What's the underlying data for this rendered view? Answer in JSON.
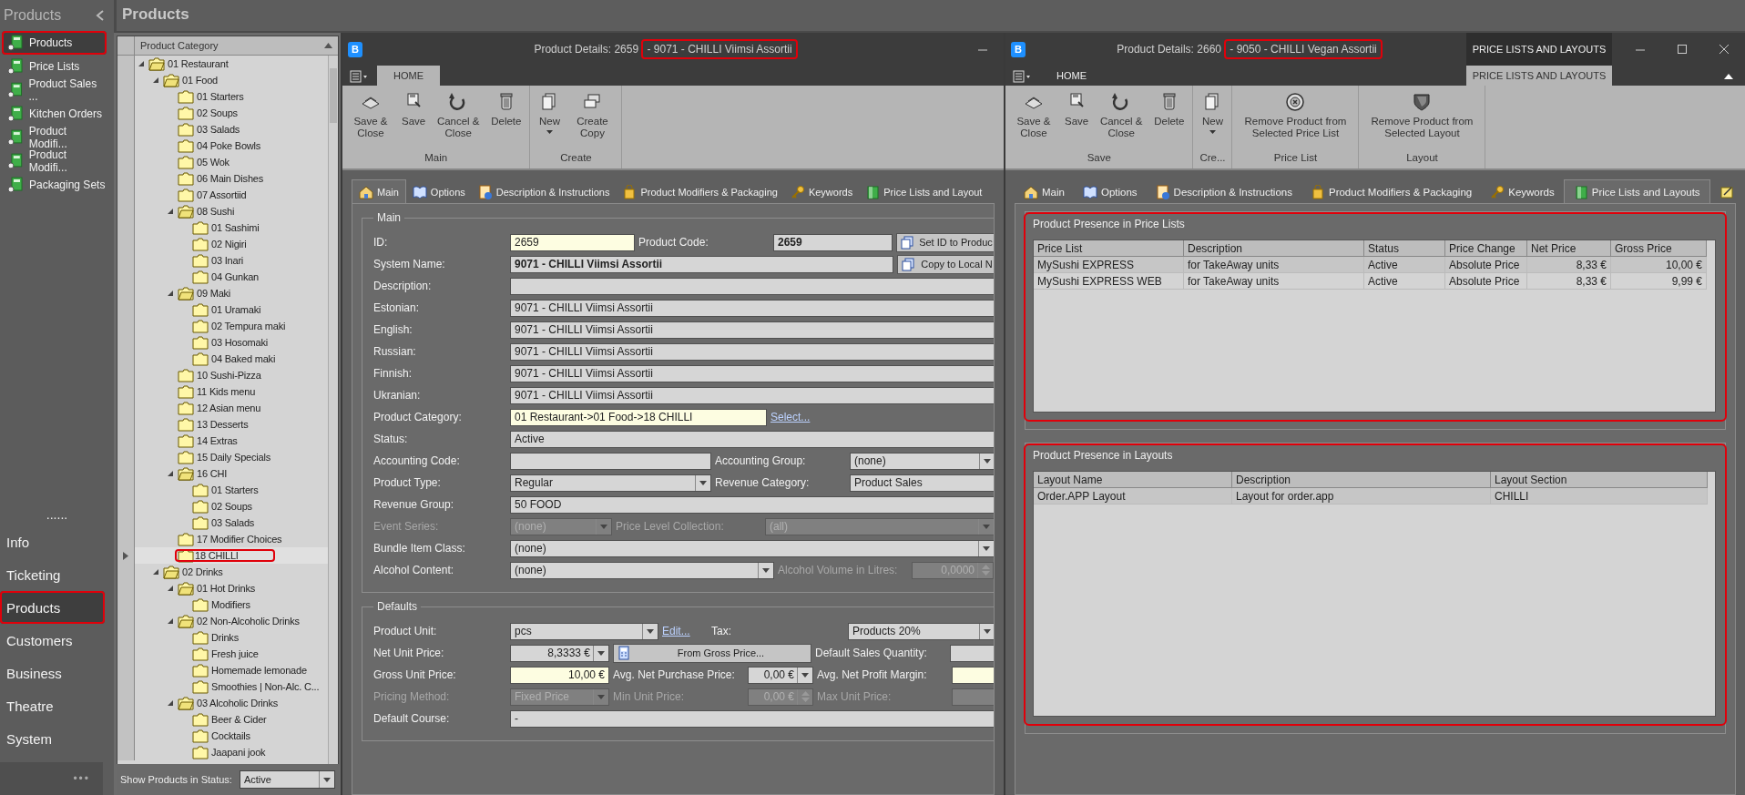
{
  "nav": {
    "title": "Products",
    "items": [
      {
        "label": "Products",
        "selected": true,
        "highlighted": true
      },
      {
        "label": "Price Lists",
        "selected": false,
        "highlighted": false
      },
      {
        "label": "Product Sales ...",
        "selected": false,
        "highlighted": false
      },
      {
        "label": "Kitchen Orders",
        "selected": false,
        "highlighted": false
      },
      {
        "label": "Product Modifi...",
        "selected": false,
        "highlighted": false
      },
      {
        "label": "Product Modifi...",
        "selected": false,
        "highlighted": false
      },
      {
        "label": "Packaging Sets",
        "selected": false,
        "highlighted": false
      }
    ],
    "divider": "......",
    "sections": [
      {
        "label": "Info",
        "selected": false,
        "highlighted": false
      },
      {
        "label": "Ticketing",
        "selected": false,
        "highlighted": false
      },
      {
        "label": "Products",
        "selected": true,
        "highlighted": true
      },
      {
        "label": "Customers",
        "selected": false,
        "highlighted": false
      },
      {
        "label": "Business",
        "selected": false,
        "highlighted": false
      },
      {
        "label": "Theatre",
        "selected": false,
        "highlighted": false
      },
      {
        "label": "System",
        "selected": false,
        "highlighted": false
      }
    ],
    "more": "•••"
  },
  "page_title": "Products",
  "tree": {
    "column": "Product Category",
    "items": [
      {
        "label": "01 Restaurant",
        "selected": false,
        "expanded": true,
        "children": [
          {
            "label": "01 Food",
            "selected": false,
            "expanded": true,
            "children": [
              {
                "label": "01 Starters",
                "selected": false
              },
              {
                "label": "02 Soups",
                "selected": false
              },
              {
                "label": "03 Salads",
                "selected": false
              },
              {
                "label": "04 Poke Bowls",
                "selected": false
              },
              {
                "label": "05 Wok",
                "selected": false
              },
              {
                "label": "06 Main Dishes",
                "selected": false
              },
              {
                "label": "07 Assortiid",
                "selected": false
              },
              {
                "label": "08 Sushi",
                "selected": false,
                "expanded": true,
                "children": [
                  {
                    "label": "01 Sashimi",
                    "selected": false
                  },
                  {
                    "label": "02 Nigiri",
                    "selected": false
                  },
                  {
                    "label": "03 Inari",
                    "selected": false
                  },
                  {
                    "label": "04 Gunkan",
                    "selected": false
                  }
                ]
              },
              {
                "label": "09 Maki",
                "selected": false,
                "expanded": true,
                "children": [
                  {
                    "label": "01 Uramaki",
                    "selected": false
                  },
                  {
                    "label": "02 Tempura maki",
                    "selected": false
                  },
                  {
                    "label": "03 Hosomaki",
                    "selected": false
                  },
                  {
                    "label": "04 Baked maki",
                    "selected": false
                  }
                ]
              },
              {
                "label": "10 Sushi-Pizza",
                "selected": false
              },
              {
                "label": "11 Kids menu",
                "selected": false
              },
              {
                "label": "12 Asian menu",
                "selected": false
              },
              {
                "label": "13 Desserts",
                "selected": false
              },
              {
                "label": "14 Extras",
                "selected": false
              },
              {
                "label": "15 Daily Specials",
                "selected": false
              },
              {
                "label": "16 CHI",
                "selected": false,
                "expanded": true,
                "children": [
                  {
                    "label": "01 Starters",
                    "selected": false
                  },
                  {
                    "label": "02 Soups",
                    "selected": false
                  },
                  {
                    "label": "03 Salads",
                    "selected": false
                  }
                ]
              },
              {
                "label": "17 Modifier Choices",
                "selected": false
              },
              {
                "label": "18 CHILLI",
                "selected": true,
                "highlighted": true
              }
            ]
          },
          {
            "label": "02 Drinks",
            "selected": false,
            "expanded": true,
            "children": [
              {
                "label": "01 Hot Drinks",
                "selected": false,
                "expanded": true,
                "children": [
                  {
                    "label": "Modifiers",
                    "selected": false
                  }
                ]
              },
              {
                "label": "02 Non-Alcoholic Drinks",
                "selected": false,
                "expanded": true,
                "children": [
                  {
                    "label": "Drinks",
                    "selected": false
                  },
                  {
                    "label": "Fresh juice",
                    "selected": false
                  },
                  {
                    "label": "Homemade lemonade",
                    "selected": false
                  },
                  {
                    "label": "Smoothies | Non-Alc. C...",
                    "selected": false
                  }
                ]
              },
              {
                "label": "03 Alcoholic Drinks",
                "selected": false,
                "expanded": true,
                "children": [
                  {
                    "label": "Beer & Cider",
                    "selected": false
                  },
                  {
                    "label": "Cocktails",
                    "selected": false
                  },
                  {
                    "label": "Jaapani jook",
                    "selected": false
                  }
                ]
              }
            ]
          }
        ]
      }
    ],
    "filter_label": "Show Products in Status:",
    "filter_value": "Active"
  },
  "windows": [
    {
      "logo": "B",
      "title": "Product Details: 2659",
      "title_marked": "- 9071 - CHILLI Viimsi Assortii",
      "ribbon_tabs": [
        {
          "label": "HOME",
          "selected": true,
          "kind": "normal"
        }
      ],
      "ribbon_groups": [
        {
          "label": "Main",
          "buttons": [
            {
              "label": "Save & Close",
              "kind": "save_close"
            },
            {
              "label": "Save",
              "kind": "save"
            },
            {
              "label": "Cancel & Close",
              "kind": "cancel_close"
            },
            {
              "label": "Delete",
              "kind": "delete"
            }
          ]
        },
        {
          "label": "Create",
          "buttons": [
            {
              "label": "New",
              "kind": "new",
              "dropdown": true
            },
            {
              "label": "Create Copy",
              "kind": "create_copy"
            }
          ]
        }
      ],
      "tabs": [
        {
          "label": "Main",
          "kind": "main",
          "selected": true
        },
        {
          "label": "Options",
          "kind": "options",
          "selected": false
        },
        {
          "label": "Description & Instructions",
          "kind": "description",
          "selected": false
        },
        {
          "label": "Product Modifiers & Packaging",
          "kind": "modifiers",
          "selected": false
        },
        {
          "label": "Keywords",
          "kind": "keywords",
          "selected": false
        },
        {
          "label": "Price Lists and Layout",
          "kind": "price_lists",
          "selected": false
        }
      ],
      "content": {
        "kind": "form",
        "groups": [
          {
            "title": "Main",
            "rows": [
              {
                "items": [
                  {
                    "kind": "label",
                    "text": "ID:"
                  },
                  {
                    "kind": "input",
                    "value": "2659",
                    "required": true
                  },
                  {
                    "kind": "label",
                    "text": "Product Code:"
                  },
                  {
                    "kind": "input",
                    "value": "2659",
                    "bold": true
                  },
                  {
                    "kind": "copy_button",
                    "text": "Set ID to Produc"
                  }
                ]
              },
              {
                "items": [
                  {
                    "kind": "label",
                    "text": "System Name:"
                  },
                  {
                    "kind": "input",
                    "value": "9071 - CHILLI Viimsi Assortii",
                    "bold": true
                  },
                  {
                    "kind": "copy_button",
                    "text": "Copy to Local N"
                  }
                ]
              },
              {
                "items": [
                  {
                    "kind": "label",
                    "text": "Description:"
                  },
                  {
                    "kind": "input"
                  }
                ]
              },
              {
                "items": [
                  {
                    "kind": "label",
                    "text": "Estonian:"
                  },
                  {
                    "kind": "input",
                    "value": "9071 - CHILLI Viimsi Assortii"
                  }
                ]
              },
              {
                "items": [
                  {
                    "kind": "label",
                    "text": "English:"
                  },
                  {
                    "kind": "input",
                    "value": "9071 - CHILLI Viimsi Assortii"
                  }
                ]
              },
              {
                "items": [
                  {
                    "kind": "label",
                    "text": "Russian:"
                  },
                  {
                    "kind": "input",
                    "value": "9071 - CHILLI Viimsi Assortii"
                  }
                ]
              },
              {
                "items": [
                  {
                    "kind": "label",
                    "text": "Finnish:"
                  },
                  {
                    "kind": "input",
                    "value": "9071 - CHILLI Viimsi Assortii"
                  }
                ]
              },
              {
                "items": [
                  {
                    "kind": "label",
                    "text": "Ukranian:"
                  },
                  {
                    "kind": "input",
                    "value": "9071 - CHILLI Viimsi Assortii"
                  }
                ]
              },
              {
                "items": [
                  {
                    "kind": "label",
                    "text": "Product Category:"
                  },
                  {
                    "kind": "input",
                    "value": "01 Restaurant->01 Food->18 CHILLI",
                    "required": true
                  },
                  {
                    "kind": "link",
                    "text": "Select..."
                  }
                ]
              },
              {
                "items": [
                  {
                    "kind": "label",
                    "text": "Status:"
                  },
                  {
                    "kind": "input",
                    "value": "Active"
                  }
                ]
              },
              {
                "items": [
                  {
                    "kind": "label",
                    "text": "Accounting Code:"
                  },
                  {
                    "kind": "input"
                  },
                  {
                    "kind": "label",
                    "text": "Accounting Group:"
                  },
                  {
                    "kind": "combo",
                    "value": "(none)"
                  }
                ]
              },
              {
                "items": [
                  {
                    "kind": "label",
                    "text": "Product Type:"
                  },
                  {
                    "kind": "combo",
                    "value": "Regular"
                  },
                  {
                    "kind": "label",
                    "text": "Revenue Category:"
                  },
                  {
                    "kind": "input",
                    "value": "Product Sales"
                  }
                ]
              },
              {
                "items": [
                  {
                    "kind": "label",
                    "text": "Revenue Group:"
                  },
                  {
                    "kind": "input",
                    "value": "50 FOOD"
                  }
                ]
              },
              {
                "items": [
                  {
                    "kind": "label",
                    "text": "Event Series:",
                    "disabled": true
                  },
                  {
                    "kind": "combo",
                    "value": "(none)",
                    "disabled": true
                  },
                  {
                    "kind": "label",
                    "text": "Price Level Collection:",
                    "disabled": true
                  },
                  {
                    "kind": "combo",
                    "value": "(all)",
                    "disabled": true
                  }
                ]
              },
              {
                "items": [
                  {
                    "kind": "label",
                    "text": "Bundle Item Class:"
                  },
                  {
                    "kind": "combo",
                    "value": "(none)"
                  }
                ]
              },
              {
                "items": [
                  {
                    "kind": "label",
                    "text": "Alcohol Content:"
                  },
                  {
                    "kind": "combo",
                    "value": "(none)"
                  },
                  {
                    "kind": "label",
                    "text": "Alcohol Volume in Litres:",
                    "disabled": true
                  },
                  {
                    "kind": "spin",
                    "value": "0,0000",
                    "disabled": true
                  }
                ]
              }
            ]
          },
          {
            "title": "Defaults",
            "rows": [
              {
                "items": [
                  {
                    "kind": "label",
                    "text": "Product Unit:"
                  },
                  {
                    "kind": "combo",
                    "value": "pcs"
                  },
                  {
                    "kind": "link",
                    "text": "Edit..."
                  },
                  {
                    "kind": "label",
                    "text": "Tax:"
                  },
                  {
                    "kind": "combo",
                    "value": "Products 20%"
                  }
                ]
              },
              {
                "items": [
                  {
                    "kind": "label",
                    "text": "Net Unit Price:"
                  },
                  {
                    "kind": "amount_combo",
                    "value": "8,3333 €"
                  },
                  {
                    "kind": "calc_button",
                    "text": "From Gross Price..."
                  },
                  {
                    "kind": "label",
                    "text": "Default Sales Quantity:"
                  },
                  {
                    "kind": "input"
                  }
                ]
              },
              {
                "items": [
                  {
                    "kind": "label",
                    "text": "Gross Unit Price:"
                  },
                  {
                    "kind": "amount",
                    "value": "10,00 €",
                    "required": true
                  },
                  {
                    "kind": "label",
                    "text": "Avg. Net Purchase Price:"
                  },
                  {
                    "kind": "amount_combo",
                    "value": "0,00 €"
                  },
                  {
                    "kind": "label",
                    "text": "Avg. Net Profit Margin:"
                  },
                  {
                    "kind": "input",
                    "required": true
                  }
                ]
              },
              {
                "items": [
                  {
                    "kind": "label",
                    "text": "Pricing Method:",
                    "disabled": true
                  },
                  {
                    "kind": "combo",
                    "value": "Fixed Price",
                    "disabled": true
                  },
                  {
                    "kind": "label",
                    "text": "Min Unit Price:",
                    "disabled": true
                  },
                  {
                    "kind": "spin",
                    "value": "0,00 €",
                    "disabled": true
                  },
                  {
                    "kind": "label",
                    "text": "Max Unit Price:",
                    "disabled": true
                  },
                  {
                    "kind": "input",
                    "disabled": true
                  }
                ]
              },
              {
                "items": [
                  {
                    "kind": "label",
                    "text": "Default Course:"
                  },
                  {
                    "kind": "input",
                    "value": "-"
                  }
                ]
              }
            ]
          }
        ]
      }
    },
    {
      "logo": "B",
      "title": "Product Details: 2660",
      "title_marked": "- 9050 - CHILLI Vegan Assortii",
      "context_title": "PRICE LISTS AND LAYOUTS",
      "ribbon_tabs": [
        {
          "label": "HOME",
          "selected": false,
          "kind": "normal"
        },
        {
          "label": "PRICE LISTS AND LAYOUTS",
          "selected": true,
          "kind": "context"
        }
      ],
      "ribbon_groups": [
        {
          "label": "Save",
          "buttons": [
            {
              "label": "Save & Close",
              "kind": "save_close"
            },
            {
              "label": "Save",
              "kind": "save"
            },
            {
              "label": "Cancel & Close",
              "kind": "cancel_close"
            },
            {
              "label": "Delete",
              "kind": "delete"
            }
          ]
        },
        {
          "label": "Cre...",
          "buttons": [
            {
              "label": "New",
              "kind": "new",
              "dropdown": true
            }
          ]
        },
        {
          "label": "Price List",
          "buttons": [
            {
              "label": "Remove Product from Selected Price List",
              "kind": "remove_price"
            }
          ]
        },
        {
          "label": "Layout",
          "buttons": [
            {
              "label": "Remove Product from Selected Layout",
              "kind": "remove_layout"
            }
          ]
        }
      ],
      "tabs": [
        {
          "label": "Main",
          "kind": "main",
          "selected": false
        },
        {
          "label": "Options",
          "kind": "options",
          "selected": false
        },
        {
          "label": "Description & Instructions",
          "kind": "description",
          "selected": false
        },
        {
          "label": "Product Modifiers & Packaging",
          "kind": "modifiers",
          "selected": false
        },
        {
          "label": "Keywords",
          "kind": "keywords",
          "selected": false
        },
        {
          "label": "Price Lists and Layouts",
          "kind": "price_lists",
          "selected": true
        },
        {
          "kind": "notes",
          "selected": false
        }
      ],
      "content": {
        "kind": "presence",
        "groups": [
          {
            "title": "Product Presence in Price Lists",
            "highlighted": true,
            "table": {
              "columns": [
                "Price List",
                "Description",
                "Status",
                "Price Change",
                "Net Price",
                "Gross Price"
              ],
              "rows": [
                {
                  "selected": true,
                  "cells": [
                    "MySushi EXPRESS",
                    "for TakeAway units",
                    "Active",
                    "Absolute Price",
                    "8,33 €",
                    "10,00 €"
                  ]
                },
                {
                  "selected": false,
                  "cells": [
                    "MySushi EXPRESS WEB",
                    "for TakeAway units",
                    "Active",
                    "Absolute Price",
                    "8,33 €",
                    "9,99 €"
                  ]
                }
              ]
            }
          },
          {
            "title": "Product Presence in Layouts",
            "highlighted": true,
            "table": {
              "columns": [
                "Layout Name",
                "Description",
                "Layout Section"
              ],
              "rows": [
                {
                  "selected": true,
                  "cells": [
                    "Order.APP Layout",
                    "Layout for order.app",
                    "CHILLI"
                  ]
                }
              ]
            }
          }
        ]
      }
    }
  ]
}
